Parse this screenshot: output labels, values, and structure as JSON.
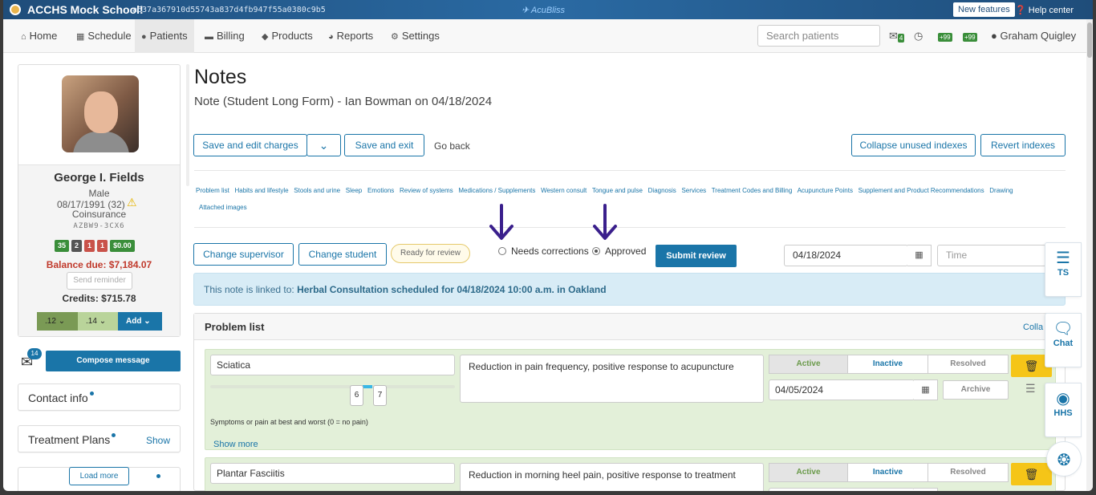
{
  "topbar": {
    "school": "ACCHS Mock School!",
    "hash": "a637a367910d55743a837d4fb947f55a0380c9b5",
    "brand": "AcuBliss",
    "new_features": "New features",
    "help": "Help center"
  },
  "nav": {
    "items": [
      "Home",
      "Schedule",
      "Patients",
      "Billing",
      "Products",
      "Reports",
      "Settings"
    ],
    "search_placeholder": "Search patients",
    "badge_count": "4",
    "plus_a": "+99",
    "plus_b": "+99",
    "user": "Graham Quigley"
  },
  "patient": {
    "name": "George I. Fields",
    "sex": "Male",
    "dob": "08/17/1991 (32)",
    "insurance": "Coinsurance",
    "code": "AZBW9-3CX6",
    "counts": [
      {
        "value": "35",
        "color": "#3a8e3a"
      },
      {
        "value": "2",
        "color": "#555555"
      },
      {
        "value": "1",
        "color": "#c9524a"
      },
      {
        "value": "1",
        "color": "#c9524a"
      },
      {
        "value": "$0.00",
        "color": "#3a8e3a"
      }
    ],
    "balance": "Balance due: $7,184.07",
    "send_reminder": "Send reminder",
    "credits": "Credits: $715.78",
    "btn_12": ".12",
    "btn_14": ".14",
    "btn_add": "Add"
  },
  "compose": {
    "badge": "14",
    "label": "Compose message"
  },
  "side": {
    "contact": "Contact info",
    "plans": "Treatment Plans",
    "plans_show": "Show",
    "load_more": "Load more"
  },
  "main": {
    "title": "Notes",
    "subtitle": "Note (Student Long Form) - Ian Bowman on 04/18/2024",
    "save_edit": "Save and edit charges",
    "save_exit": "Save and exit",
    "go_back": "Go back",
    "collapse_unused": "Collapse unused indexes",
    "revert": "Revert indexes",
    "indexes_row1": [
      "Problem list",
      "Habits and lifestyle",
      "Stools and urine",
      "Sleep",
      "Emotions",
      "Review of systems",
      "Medications / Supplements",
      "Western consult",
      "Tongue and pulse",
      "Diagnosis",
      "Services",
      "Treatment Codes and Billing",
      "Acupuncture Points",
      "Supplement and Product Recommendations",
      "Drawing"
    ],
    "indexes_row2": [
      "Attached images"
    ],
    "change_supervisor": "Change supervisor",
    "change_student": "Change student",
    "ready": "Ready for review",
    "needs_corrections": "Needs corrections",
    "approved": "Approved",
    "submit": "Submit review",
    "date": "04/18/2024",
    "time_placeholder": "Time",
    "linked_prefix": "This note is linked to: ",
    "linked_detail": "Herbal Consultation scheduled for 04/18/2024 10:00 a.m. in Oakland"
  },
  "problems": {
    "title": "Problem list",
    "collapse": "Colla",
    "rows": [
      {
        "name": "Sciatica",
        "note": "Reduction in pain frequency, positive response to acupuncture",
        "active": "Active",
        "inactive": "Inactive",
        "resolved": "Resolved",
        "date": "04/05/2024",
        "archive": "Archive",
        "best": "6",
        "worst": "7",
        "pain_label": "Symptoms or pain at best and worst (0 = no pain)",
        "show_more": "Show more"
      },
      {
        "name": "Plantar Fasciitis",
        "note": "Reduction in morning heel pain, positive response to treatment",
        "active": "Active",
        "inactive": "Inactive",
        "resolved": "Resolved"
      }
    ]
  },
  "floating": {
    "ts": "TS",
    "chat": "Chat",
    "hhs": "HHS"
  }
}
